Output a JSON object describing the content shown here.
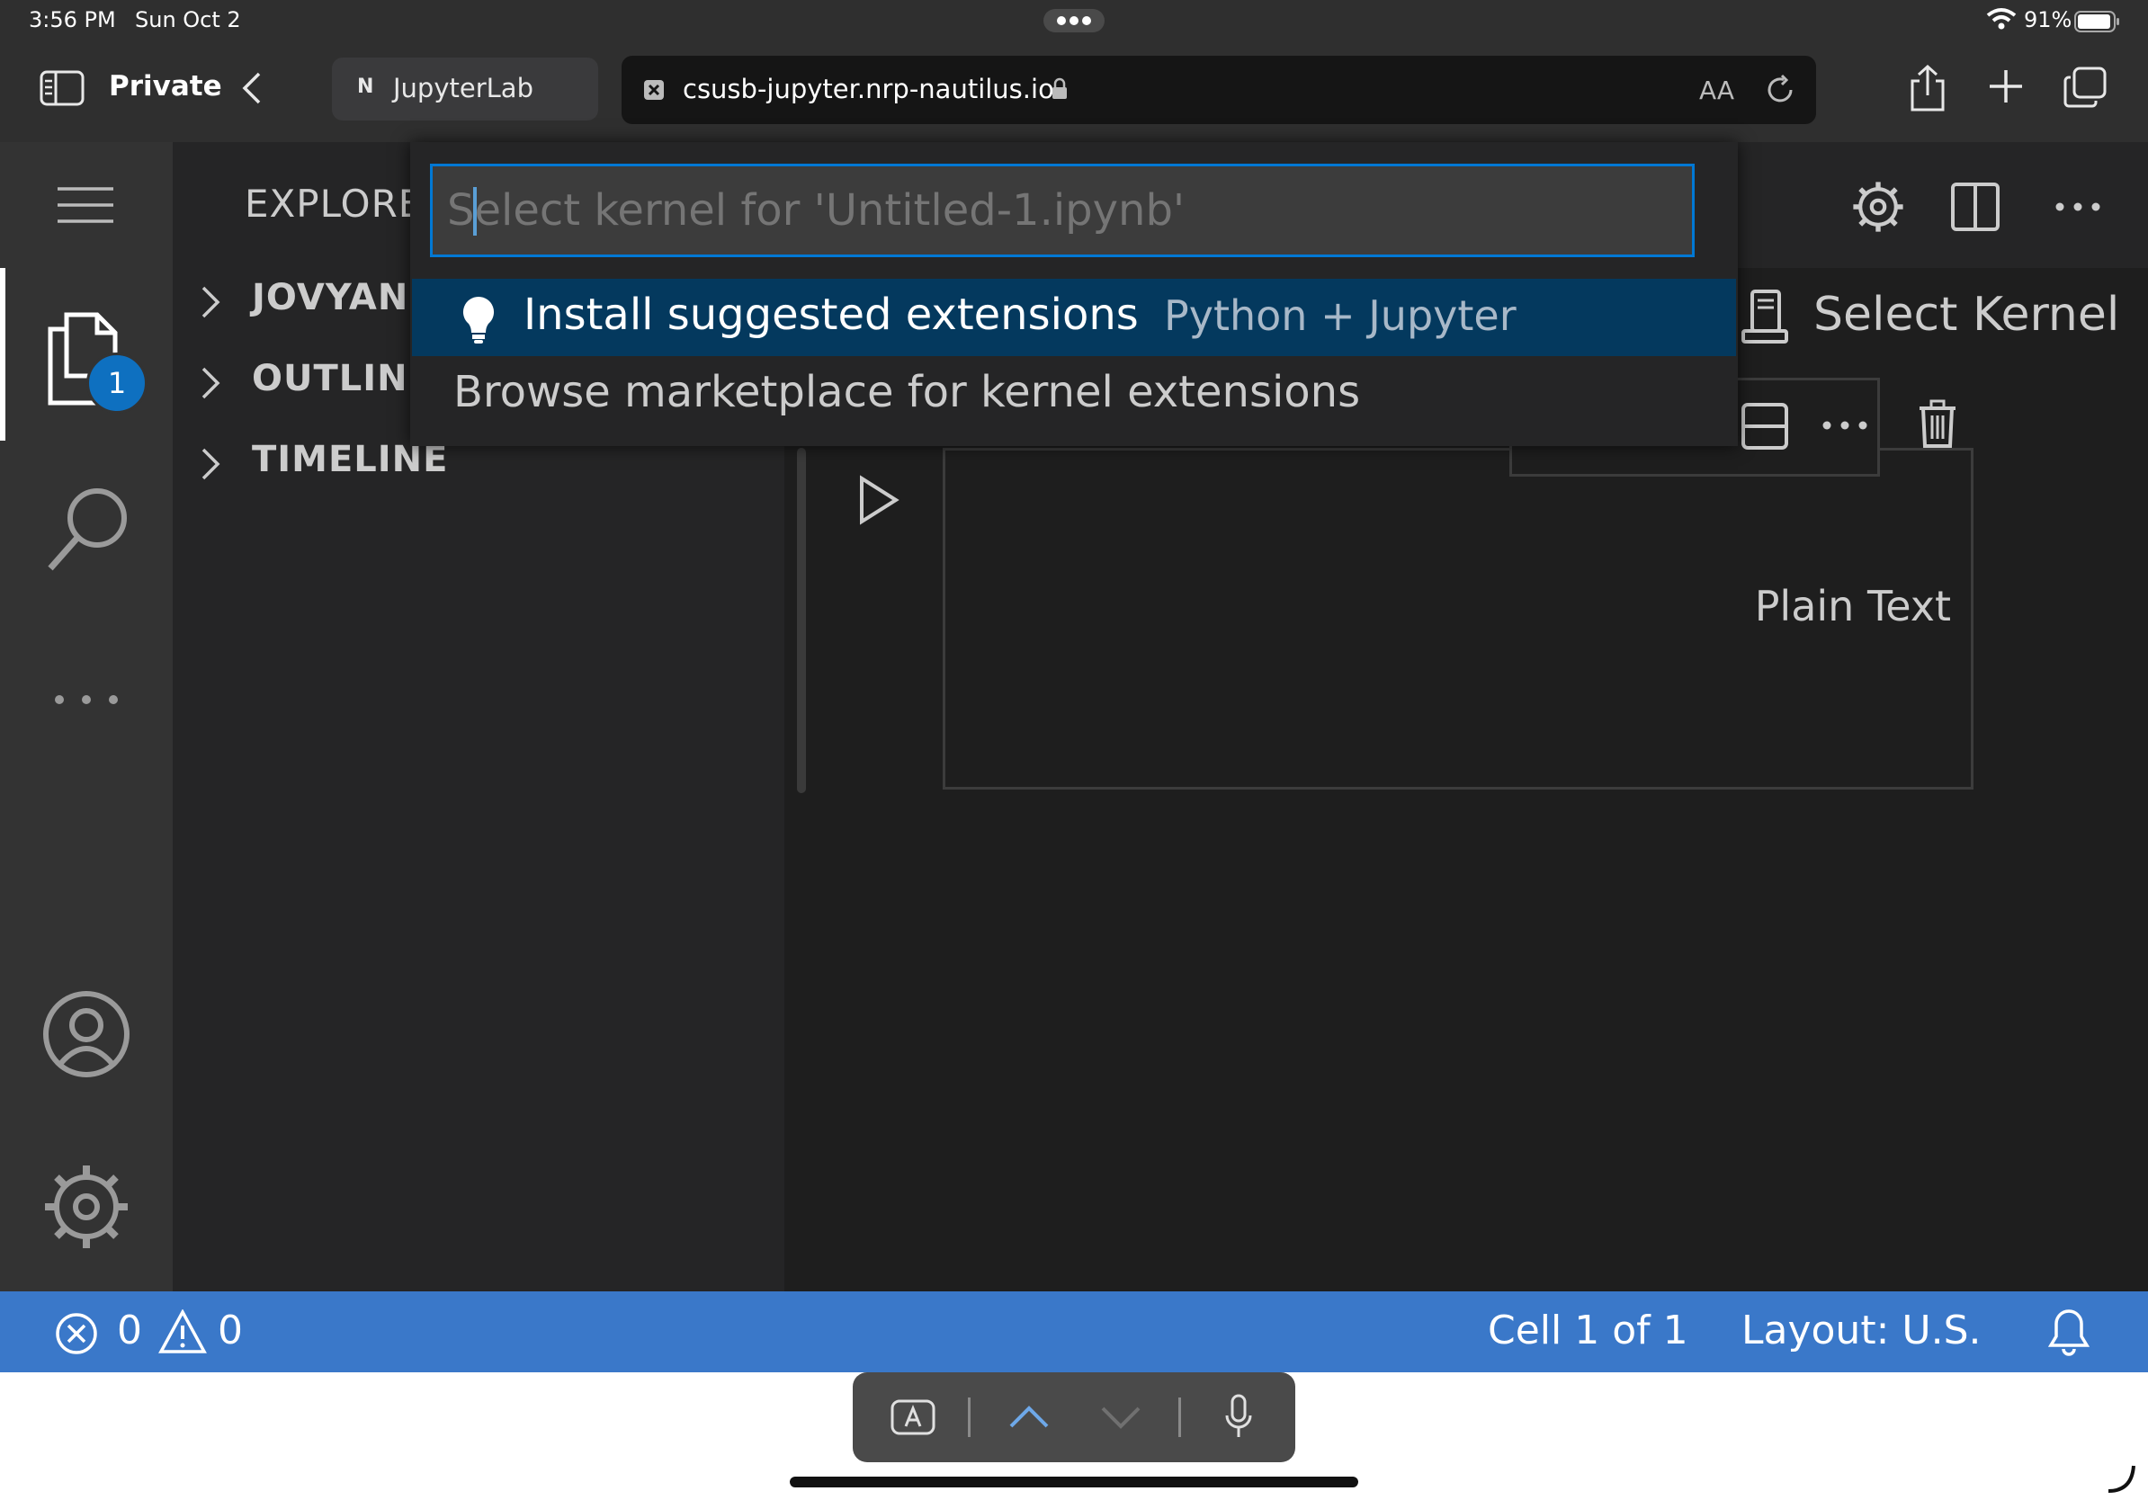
{
  "ios_status": {
    "time": "3:56 PM",
    "date": "Sun Oct 2",
    "battery": "91%"
  },
  "safari": {
    "private_label": "Private",
    "tab_favicon": "N",
    "tab_title": "JupyterLab",
    "url": "csusb-jupyter.nrp-nautilus.io",
    "reader_label": "AA"
  },
  "sidebar": {
    "title": "EXPLORER",
    "sections": [
      "JOVYAN",
      "OUTLINE",
      "TIMELINE"
    ]
  },
  "activity_bar": {
    "explorer_badge": "1"
  },
  "quick_pick": {
    "placeholder": "Select kernel for 'Untitled-1.ipynb'",
    "items": [
      {
        "label": "Install suggested extensions",
        "description": "Python + Jupyter"
      },
      {
        "label": "Browse marketplace for kernel extensions",
        "description": ""
      }
    ]
  },
  "editor": {
    "select_kernel": "Select Kernel",
    "cell_language": "Plain Text"
  },
  "status_bar": {
    "errors": "0",
    "warnings": "0",
    "cell_position": "Cell 1 of 1",
    "layout": "Layout: U.S."
  },
  "colors": {
    "accent": "#0078d4",
    "status_bar": "#3a78c9",
    "selection": "#04395e"
  }
}
